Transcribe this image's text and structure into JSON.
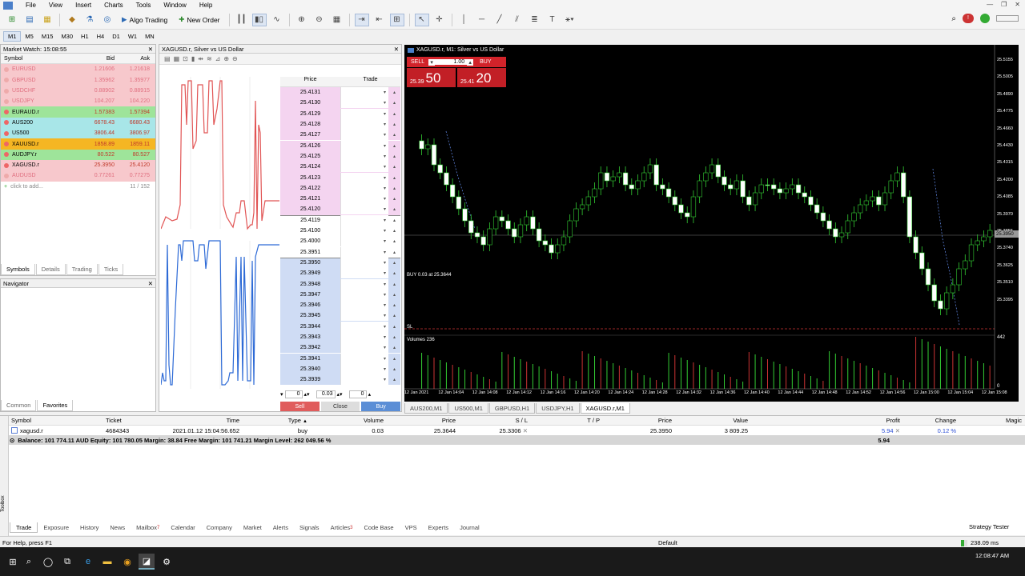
{
  "menu": [
    "File",
    "View",
    "Insert",
    "Charts",
    "Tools",
    "Window",
    "Help"
  ],
  "toolbar": {
    "algo_trading": "Algo Trading",
    "new_order": "New Order"
  },
  "timeframes": [
    "M1",
    "M5",
    "M15",
    "M30",
    "H1",
    "H4",
    "D1",
    "W1",
    "MN"
  ],
  "active_timeframe": "M1",
  "market_watch": {
    "title": "Market Watch: 15:08:55",
    "headers": {
      "symbol": "Symbol",
      "bid": "Bid",
      "ask": "Ask"
    },
    "rows": [
      {
        "symbol": "EURUSD",
        "bid": "1.21606",
        "ask": "1.21618",
        "bg": "#f7c8cc",
        "dim": true
      },
      {
        "symbol": "GBPUSD",
        "bid": "1.35962",
        "ask": "1.35977",
        "bg": "#f7c8cc",
        "dim": true
      },
      {
        "symbol": "USDCHF",
        "bid": "0.88902",
        "ask": "0.88915",
        "bg": "#f7c8cc",
        "dim": true
      },
      {
        "symbol": "USDJPY",
        "bid": "104.207",
        "ask": "104.220",
        "bg": "#f7c8cc",
        "dim": true
      },
      {
        "symbol": "EURAUD.r",
        "bid": "1.57383",
        "ask": "1.57394",
        "bg": "#9ee49a",
        "dim": false
      },
      {
        "symbol": "AUS200",
        "bid": "6678.43",
        "ask": "6680.43",
        "bg": "#a8e6e8",
        "dim": false
      },
      {
        "symbol": "US500",
        "bid": "3806.44",
        "ask": "3806.97",
        "bg": "#a8e6e8",
        "dim": false
      },
      {
        "symbol": "XAUUSD.r",
        "bid": "1858.89",
        "ask": "1859.11",
        "bg": "#f5b623",
        "dim": false
      },
      {
        "symbol": "AUDJPY.r",
        "bid": "80.522",
        "ask": "80.527",
        "bg": "#9ee49a",
        "dim": false
      },
      {
        "symbol": "XAGUSD.r",
        "bid": "25.3950",
        "ask": "25.4120",
        "bg": "#f7c8cc",
        "dim": false
      },
      {
        "symbol": "AUDUSD",
        "bid": "0.77261",
        "ask": "0.77275",
        "bg": "#f7c8cc",
        "dim": true
      }
    ],
    "add_label": "click to add...",
    "count": "11 / 152",
    "tabs": [
      "Symbols",
      "Details",
      "Trading",
      "Ticks"
    ]
  },
  "navigator": {
    "title": "Navigator",
    "tabs": [
      "Common",
      "Favorites"
    ]
  },
  "depth": {
    "title": "XAGUSD.r, Silver vs US Dollar",
    "headers": {
      "price": "Price",
      "trade": "Trade"
    },
    "prices": [
      "25.4131",
      "25.4130",
      "25.4129",
      "25.4128",
      "25.4127",
      "25.4126",
      "25.4125",
      "25.4124",
      "25.4123",
      "25.4122",
      "25.4121",
      "25.4120",
      "25.4119",
      "25.4100",
      "25.4000",
      "25.3951",
      "25.3950",
      "25.3949",
      "25.3948",
      "25.3947",
      "25.3946",
      "25.3945",
      "25.3944",
      "25.3943",
      "25.3942",
      "25.3941",
      "25.3940",
      "25.3939"
    ],
    "sl_value": "0",
    "volume": "0.03",
    "tp_value": "0",
    "sell_label": "Sell",
    "close_label": "Close",
    "buy_label": "Buy"
  },
  "chart": {
    "title": "XAGUSD.r, M1: Silver vs US Dollar",
    "sell_label": "SELL",
    "buy_label": "BUY",
    "lot": "1.00",
    "sell_small": "25.39",
    "sell_big": "50",
    "buy_small": "25.41",
    "buy_big": "20",
    "position_label": "BUY 0.03 at 25.3644",
    "sl_label": "SL",
    "volumes_label": "Volumes 236",
    "volume_axis_top": "442",
    "volume_axis_bottom": "0",
    "price_axis": [
      "25.5155",
      "25.5005",
      "25.4890",
      "25.4775",
      "25.4660",
      "25.4430",
      "25.4315",
      "25.4200",
      "25.4085",
      "25.3970",
      "25.3855",
      "25.3740",
      "25.3625",
      "25.3510",
      "25.3395"
    ],
    "time_axis": [
      "12 Jan 2021",
      "12 Jan 14:04",
      "12 Jan 14:08",
      "12 Jan 14:12",
      "12 Jan 14:16",
      "12 Jan 14:20",
      "12 Jan 14:24",
      "12 Jan 14:28",
      "12 Jan 14:32",
      "12 Jan 14:36",
      "12 Jan 14:40",
      "12 Jan 14:44",
      "12 Jan 14:48",
      "12 Jan 14:52",
      "12 Jan 14:56",
      "12 Jan 15:00",
      "12 Jan 15:04",
      "12 Jan 15:08"
    ],
    "tabs": [
      "AUS200,M1",
      "US500,M1",
      "GBPUSD,H1",
      "USDJPY,H1",
      "XAGUSD.r,M1"
    ],
    "active_tab": "XAGUSD.r,M1"
  },
  "terminal": {
    "headers": {
      "symbol": "Symbol",
      "ticket": "Ticket",
      "time": "Time",
      "type": "Type",
      "volume": "Volume",
      "price": "Price",
      "sl": "S / L",
      "tp": "T / P",
      "price2": "Price",
      "value": "Value",
      "profit": "Profit",
      "change": "Change",
      "magic": "Magic"
    },
    "row": {
      "symbol": "xagusd.r",
      "ticket": "4684343",
      "time": "2021.01.12 15:04:56.652",
      "type": "buy",
      "volume": "0.03",
      "price": "25.3644",
      "sl": "25.3306",
      "price2": "25.3950",
      "value": "3 809.25",
      "profit": "5.94",
      "change": "0.12 %"
    },
    "balance": "Balance: 101 774.11 AUD  Equity: 101 780.05  Margin: 38.84  Free Margin: 101 741.21  Margin Level: 262 049.56 %",
    "balance_profit": "5.94",
    "tabs": [
      "Trade",
      "Exposure",
      "History",
      "News",
      "Mailbox",
      "Calendar",
      "Company",
      "Market",
      "Alerts",
      "Signals",
      "Articles",
      "Code Base",
      "VPS",
      "Experts",
      "Journal"
    ],
    "mailbox_badge": "7",
    "articles_badge": "3",
    "strategy_tester": "Strategy Tester",
    "side_label": "Toolbox"
  },
  "status": {
    "help": "For Help, press F1",
    "profile": "Default",
    "ping": "238.09 ms"
  },
  "taskbar": {
    "time": "12:08:47 AM"
  }
}
